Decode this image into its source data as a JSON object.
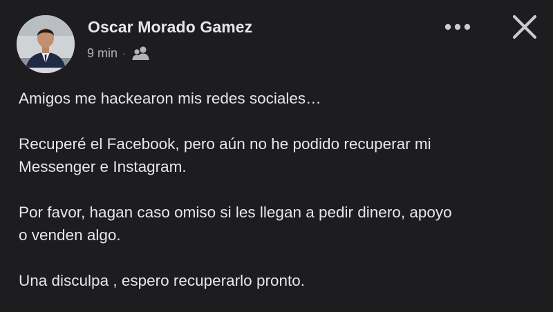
{
  "post": {
    "author": "Oscar Morado Gamez",
    "time": "9 min",
    "separator": "·",
    "audience_icon": "friends-icon",
    "more_icon": "more-options-icon",
    "close_icon": "close-icon",
    "paragraphs": [
      {
        "lines": [
          "Amigos me hackearon mis redes sociales…"
        ]
      },
      {
        "lines": [
          "Recuperé el Facebook, pero aún no he podido recuperar mi",
          "Messenger e Instagram."
        ]
      },
      {
        "lines": [
          "Por favor, hagan caso omiso si les llegan a pedir dinero, apoyo",
          "o venden algo."
        ]
      },
      {
        "lines": [
          "Una disculpa , espero recuperarlo pronto."
        ]
      }
    ]
  },
  "colors": {
    "background": "#1d1d1f",
    "primary_text": "#e6e7ea",
    "secondary_text": "#b0b3b8"
  }
}
